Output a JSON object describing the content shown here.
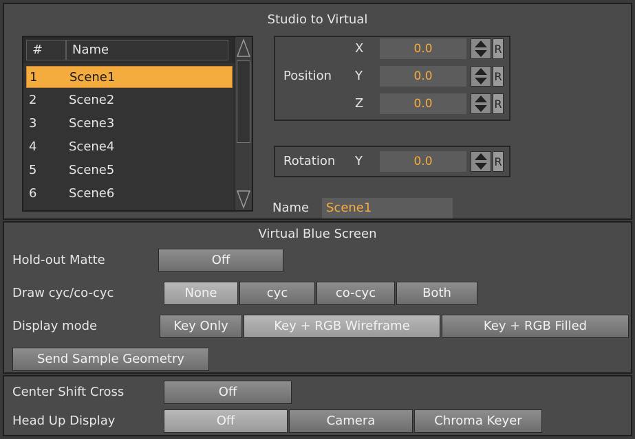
{
  "studio": {
    "title": "Studio to Virtual",
    "list": {
      "col_num": "#",
      "col_name": "Name",
      "rows": [
        {
          "num": "1",
          "name": "Scene1"
        },
        {
          "num": "2",
          "name": "Scene2"
        },
        {
          "num": "3",
          "name": "Scene3"
        },
        {
          "num": "4",
          "name": "Scene4"
        },
        {
          "num": "5",
          "name": "Scene5"
        },
        {
          "num": "6",
          "name": "Scene6"
        }
      ],
      "selected_index": 0
    },
    "position": {
      "label": "Position",
      "x_label": "X",
      "x_value": "0.0",
      "y_label": "Y",
      "y_value": "0.0",
      "z_label": "Z",
      "z_value": "0.0",
      "reset": "R"
    },
    "rotation": {
      "label": "Rotation",
      "y_label": "Y",
      "y_value": "0.0",
      "reset": "R"
    },
    "name_label": "Name",
    "name_value": "Scene1"
  },
  "blue_screen": {
    "title": "Virtual Blue Screen",
    "hold_out": {
      "label": "Hold-out Matte",
      "value": "Off"
    },
    "draw_cyc": {
      "label": "Draw cyc/co-cyc",
      "options": [
        "None",
        "cyc",
        "co-cyc",
        "Both"
      ],
      "selected": "None"
    },
    "display_mode": {
      "label": "Display mode",
      "options": [
        "Key Only",
        "Key + RGB Wireframe",
        "Key + RGB Filled"
      ],
      "selected": "Key + RGB Wireframe"
    },
    "send_sample": "Send Sample Geometry"
  },
  "bottom": {
    "center_shift": {
      "label": "Center Shift Cross",
      "value": "Off"
    },
    "hud": {
      "label": "Head Up Display",
      "options": [
        "Off",
        "Camera",
        "Chroma Keyer"
      ],
      "selected": "Off"
    }
  },
  "colors": {
    "accent": "#f5ac3f",
    "panel": "#4a4a4a",
    "background": "#3a3a3a"
  }
}
